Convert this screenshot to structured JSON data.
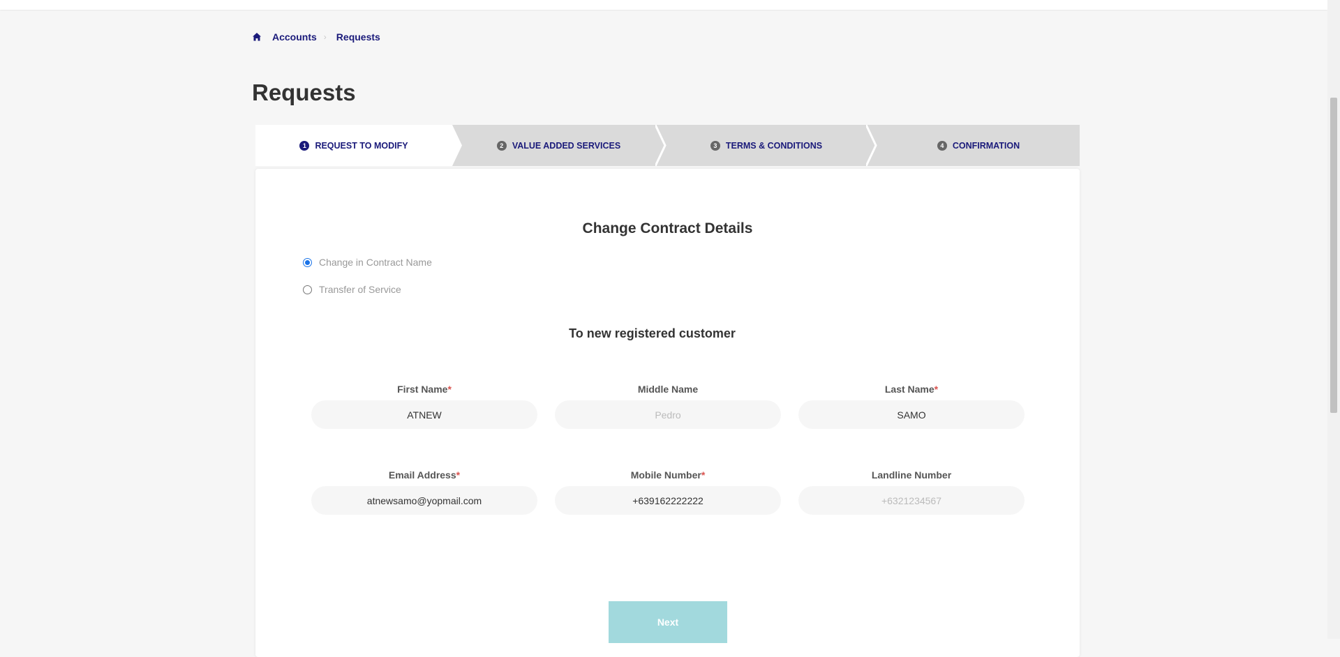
{
  "breadcrumb": {
    "home_icon": "home-icon",
    "items": [
      "Accounts",
      "Requests"
    ]
  },
  "page": {
    "title": "Requests"
  },
  "steps": [
    {
      "num": "1",
      "label": "REQUEST TO MODIFY",
      "active": true
    },
    {
      "num": "2",
      "label": "VALUE ADDED SERVICES",
      "active": false
    },
    {
      "num": "3",
      "label": "TERMS & CONDITIONS",
      "active": false
    },
    {
      "num": "4",
      "label": "CONFIRMATION",
      "active": false
    }
  ],
  "form": {
    "title": "Change Contract Details",
    "options": [
      {
        "label": "Change in Contract Name",
        "checked": true
      },
      {
        "label": "Transfer of Service",
        "checked": false
      }
    ],
    "section_title": "To new registered customer",
    "fields": {
      "first_name": {
        "label": "First Name",
        "required": "*",
        "value": "ATNEW",
        "placeholder": ""
      },
      "middle_name": {
        "label": "Middle Name",
        "required": "",
        "value": "",
        "placeholder": "Pedro"
      },
      "last_name": {
        "label": "Last Name",
        "required": "*",
        "value": "SAMO",
        "placeholder": ""
      },
      "email": {
        "label": "Email Address",
        "required": "*",
        "value": "atnewsamo@yopmail.com",
        "placeholder": ""
      },
      "mobile": {
        "label": "Mobile Number",
        "required": "*",
        "value": "+639162222222",
        "placeholder": ""
      },
      "landline": {
        "label": "Landline Number",
        "required": "",
        "value": "",
        "placeholder": "+6321234567"
      }
    },
    "next_label": "Next"
  },
  "colors": {
    "brand": "#1a1a7a",
    "button": "#a2d9dd",
    "radio": "#1a73e8",
    "required": "#d9534f"
  }
}
